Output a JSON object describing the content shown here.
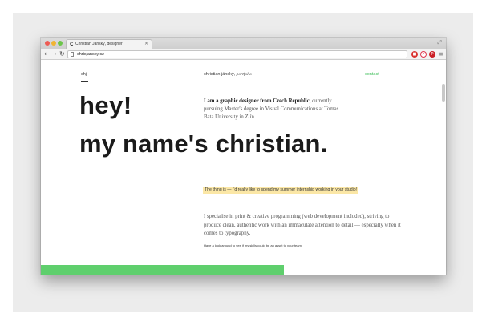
{
  "browser": {
    "tab_favicon": "C",
    "tab_title": "Christian Jánský, designer",
    "tab_close": "×",
    "url": "chrisjansky.cz",
    "icons": {
      "back": "arrow-left-icon",
      "forward": "arrow-right-icon",
      "reload": "reload-icon",
      "menu": "hamburger-menu-icon",
      "resize": "fullscreen-icon"
    },
    "extensions": [
      "adblock-icon",
      "pocket-icon",
      "pinterest-icon"
    ]
  },
  "site_nav": {
    "logo": "chj",
    "name": "christian jánský, ",
    "name_suffix": "portfolio",
    "contact": "contact"
  },
  "hero": {
    "line1": "hey!",
    "line2": "my name's christian."
  },
  "intro": {
    "bold": "I am a graphic designer from Czech Republic,",
    "rest": " currently pursuing Master's degree in Visual Communications at Tomas Bata University in Zlín."
  },
  "highlight": "The thing is — I'd really like to spend my summer internship working in your studio!",
  "specialty": "I specialise in print & creative programming (web development included), striving to produce clean, authentic work with an immaculate attention to detail — especially when it comes to typography.",
  "footnote": "Have a look around to see if my skills could be an asset to your team.",
  "colors": {
    "accent": "#3fbf5a",
    "highlight": "#fbe7a6",
    "green_bar": "#5fcf6d"
  }
}
